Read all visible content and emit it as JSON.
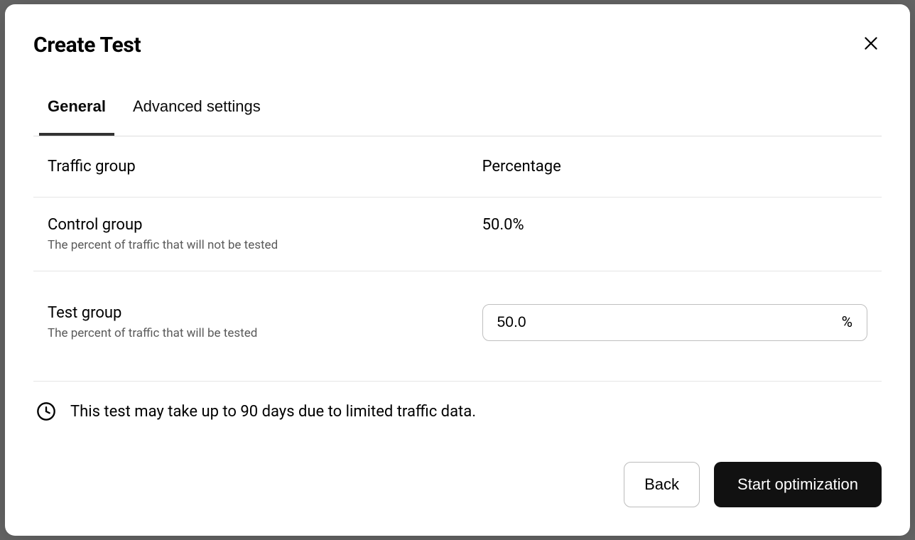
{
  "modal": {
    "title": "Create Test"
  },
  "tabs": {
    "general": "General",
    "advanced": "Advanced settings"
  },
  "table": {
    "headers": {
      "group": "Traffic group",
      "percentage": "Percentage"
    },
    "control": {
      "name": "Control group",
      "desc": "The percent of traffic that will not be tested",
      "value": "50.0%"
    },
    "test": {
      "name": "Test group",
      "desc": "The percent of traffic that will be tested",
      "value": "50.0",
      "suffix": "%"
    }
  },
  "notice": {
    "text": "This test may take up to 90 days due to limited traffic data."
  },
  "footer": {
    "back": "Back",
    "start": "Start optimization"
  }
}
